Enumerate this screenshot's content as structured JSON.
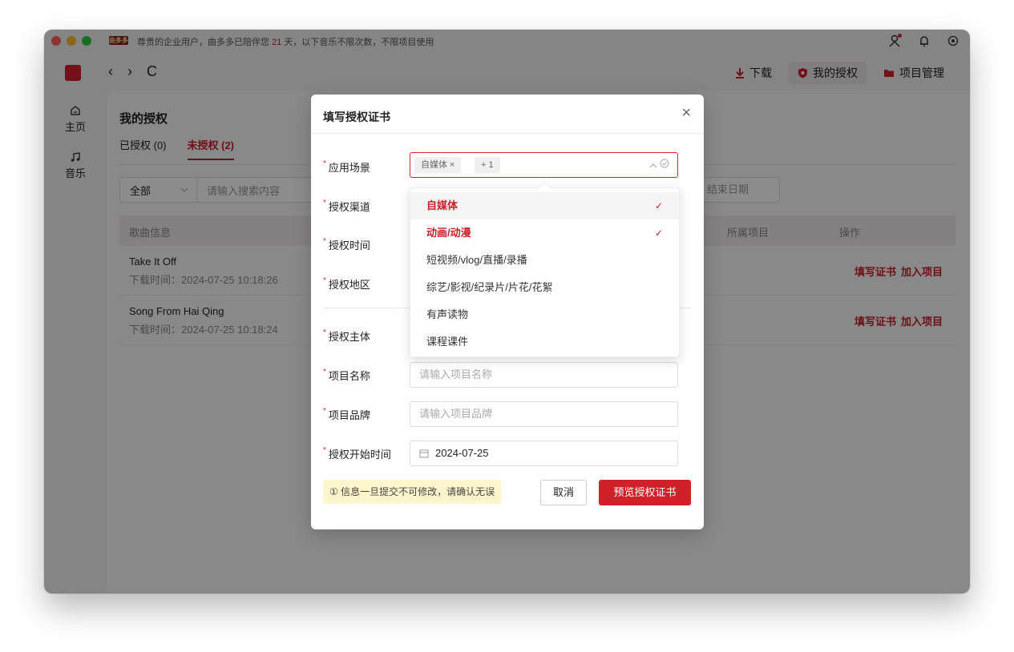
{
  "titlebar": {
    "vip_badge": "曲多多",
    "notice_prefix": "尊贵的企业用户，曲多多已陪伴您",
    "notice_days": "21",
    "notice_suffix": "天，以下音乐不限次数，不限项目使用"
  },
  "nav": {
    "back": "‹",
    "forward": "›",
    "refresh": "C",
    "download": "下载",
    "my_license": "我的授权",
    "project_mgmt": "项目管理"
  },
  "sidebar": {
    "items": [
      {
        "label": "主页",
        "icon": "home-icon"
      },
      {
        "label": "音乐",
        "icon": "music-note-icon"
      }
    ]
  },
  "page": {
    "title": "我的授权",
    "tabs": [
      "已授权 (0)",
      "未授权 (2)"
    ],
    "filter_select": "全部",
    "search_placeholder": "请输入搜索内容",
    "end_date_placeholder": "结束日期",
    "columns": [
      "歌曲信息",
      "所属项目",
      "操作"
    ],
    "rows": [
      {
        "name": "Take It Off",
        "time": "下载时间：2024-07-25 10:18:26",
        "op1": "填写证书",
        "op2": "加入项目"
      },
      {
        "name": "Song From Hai Qing",
        "time": "下载时间：2024-07-25 10:18:24",
        "op1": "填写证书",
        "op2": "加入项目"
      }
    ]
  },
  "modal": {
    "title": "填写授权证书",
    "close": "×",
    "labels": {
      "scene": "应用场景",
      "channel": "授权渠道",
      "period": "授权时间",
      "region": "授权地区",
      "subject": "授权主体",
      "project_name": "项目名称",
      "project_brand": "项目品牌",
      "start_date": "授权开始时间"
    },
    "scene_tag": "自媒体 ×",
    "scene_more": "+ 1",
    "project_name_placeholder": "请输入项目名称",
    "project_brand_placeholder": "请输入项目品牌",
    "start_date_value": "2024-07-25",
    "warning": "① 信息一旦提交不可修改，请确认无误",
    "cancel": "取消",
    "preview": "预览授权证书"
  },
  "dropdown": {
    "options": [
      {
        "label": "自媒体",
        "selected": true
      },
      {
        "label": "动画/动漫",
        "selected": true
      },
      {
        "label": "短视频/vlog/直播/录播",
        "selected": false
      },
      {
        "label": "综艺/影视/纪录片/片花/花絮",
        "selected": false
      },
      {
        "label": "有声读物",
        "selected": false
      },
      {
        "label": "课程课件",
        "selected": false
      }
    ],
    "check": "✓"
  },
  "colors": {
    "accent": "#c8202a",
    "overlay": "rgba(0,0,0,0.45)"
  }
}
